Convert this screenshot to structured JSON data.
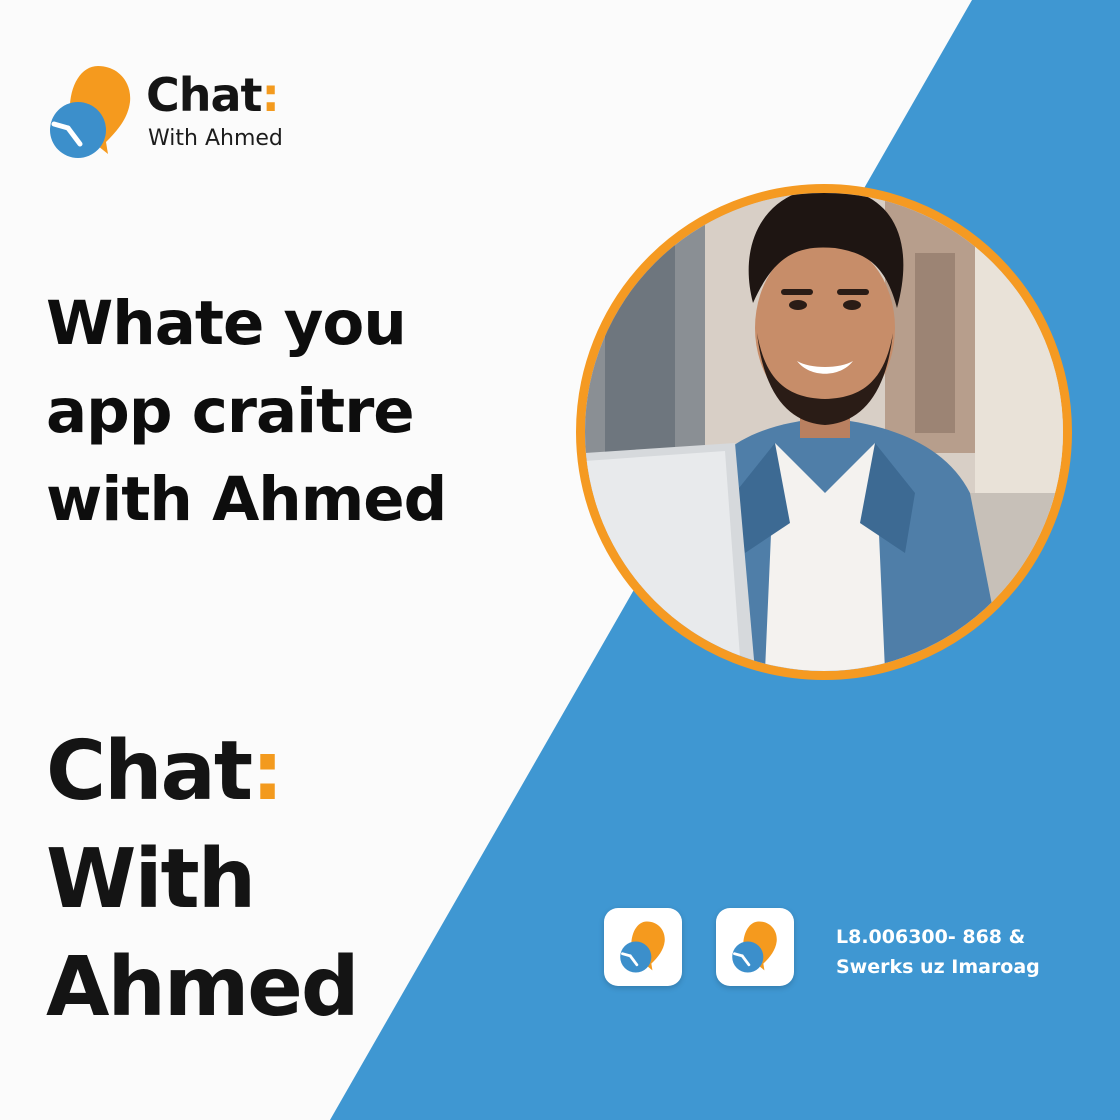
{
  "logo": {
    "brand": "Chat",
    "colon": ":",
    "tagline": "With Ahmed",
    "icon": "chat-bubble-logo-icon"
  },
  "headline": {
    "lines": [
      "Whate you",
      "app craitre",
      "with Ahmed"
    ]
  },
  "wordmark": {
    "line1_text": "Chat",
    "line1_colon": ":",
    "line2": "With",
    "line3": "Ahmed"
  },
  "photo": {
    "subject": "smiling man with laptop"
  },
  "footer": {
    "app_icons": [
      "chat-bubble-logo-icon",
      "chat-bubble-logo-icon"
    ],
    "contact_line1": "L8.006300- 868 &",
    "contact_line2": "Swerks uz Imaroag"
  },
  "colors": {
    "accent_orange": "#f39a1e",
    "accent_blue": "#3f97d2",
    "background": "#fbfbfb",
    "text_dark": "#141414"
  }
}
